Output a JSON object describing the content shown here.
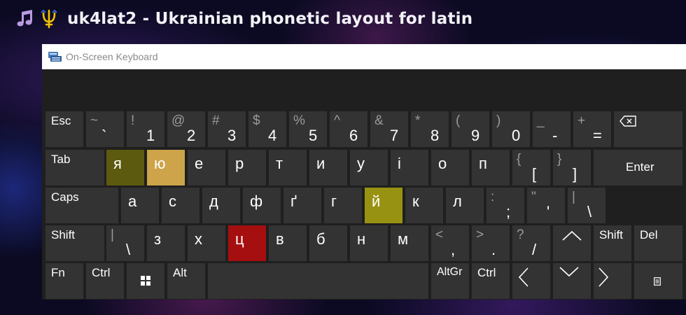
{
  "header": {
    "title": "uk4lat2 - Ukrainian phonetic layout for latin",
    "icons": [
      "music-note-icon",
      "trident-icon"
    ]
  },
  "window": {
    "title": "On-Screen Keyboard",
    "app_icon": "keyboard-icon"
  },
  "colors": {
    "ya": "#5c5a0f",
    "yu": "#cda449",
    "yi": "#989212",
    "ts": "#a50f0f",
    "key": "#333333",
    "panel": "#1f1f1f"
  },
  "keys": {
    "esc": "Esc",
    "tilde_shift": "~",
    "tilde_main": "`",
    "k1_shift": "!",
    "k1_main": "1",
    "k2_shift": "@",
    "k2_main": "2",
    "k3_shift": "#",
    "k3_main": "3",
    "k4_shift": "$",
    "k4_main": "4",
    "k5_shift": "%",
    "k5_main": "5",
    "k6_shift": "^",
    "k6_main": "6",
    "k7_shift": "&",
    "k7_main": "7",
    "k8_shift": "*",
    "k8_main": "8",
    "k9_shift": "(",
    "k9_main": "9",
    "k0_shift": ")",
    "k0_main": "0",
    "minus_shift": "_",
    "minus_main": "-",
    "equals_shift": "+",
    "equals_main": "=",
    "backspace": "backspace-icon",
    "tab": "Tab",
    "q": "я",
    "w": "ю",
    "e": "е",
    "r": "р",
    "t": "т",
    "y": "и",
    "u": "у",
    "i": "і",
    "o": "о",
    "p": "п",
    "lbracket_shift": "{",
    "lbracket_main": "[",
    "rbracket_shift": "}",
    "rbracket_main": "]",
    "enter": "Enter",
    "caps": "Caps",
    "a": "а",
    "s": "с",
    "d": "д",
    "f": "ф",
    "g": "ґ",
    "h": "г",
    "j": "й",
    "k": "к",
    "l": "л",
    "semicolon_shift": ":",
    "semicolon_main": ";",
    "quote_shift": "\"",
    "quote_main": "'",
    "backslash_shift": "|",
    "backslash_main": "\\",
    "shift_left": "Shift",
    "iso_shift": "|",
    "iso_main": "\\",
    "z": "з",
    "x": "х",
    "c": "ц",
    "v": "в",
    "b": "б",
    "n": "н",
    "m": "м",
    "comma_shift": "<",
    "comma_main": ",",
    "period_shift": ">",
    "period_main": ".",
    "slash_shift": "?",
    "slash_main": "/",
    "shift_right": "Shift",
    "del": "Del",
    "fn": "Fn",
    "ctrl_left": "Ctrl",
    "alt": "Alt",
    "altgr": "AltGr",
    "ctrl_right": "Ctrl"
  }
}
